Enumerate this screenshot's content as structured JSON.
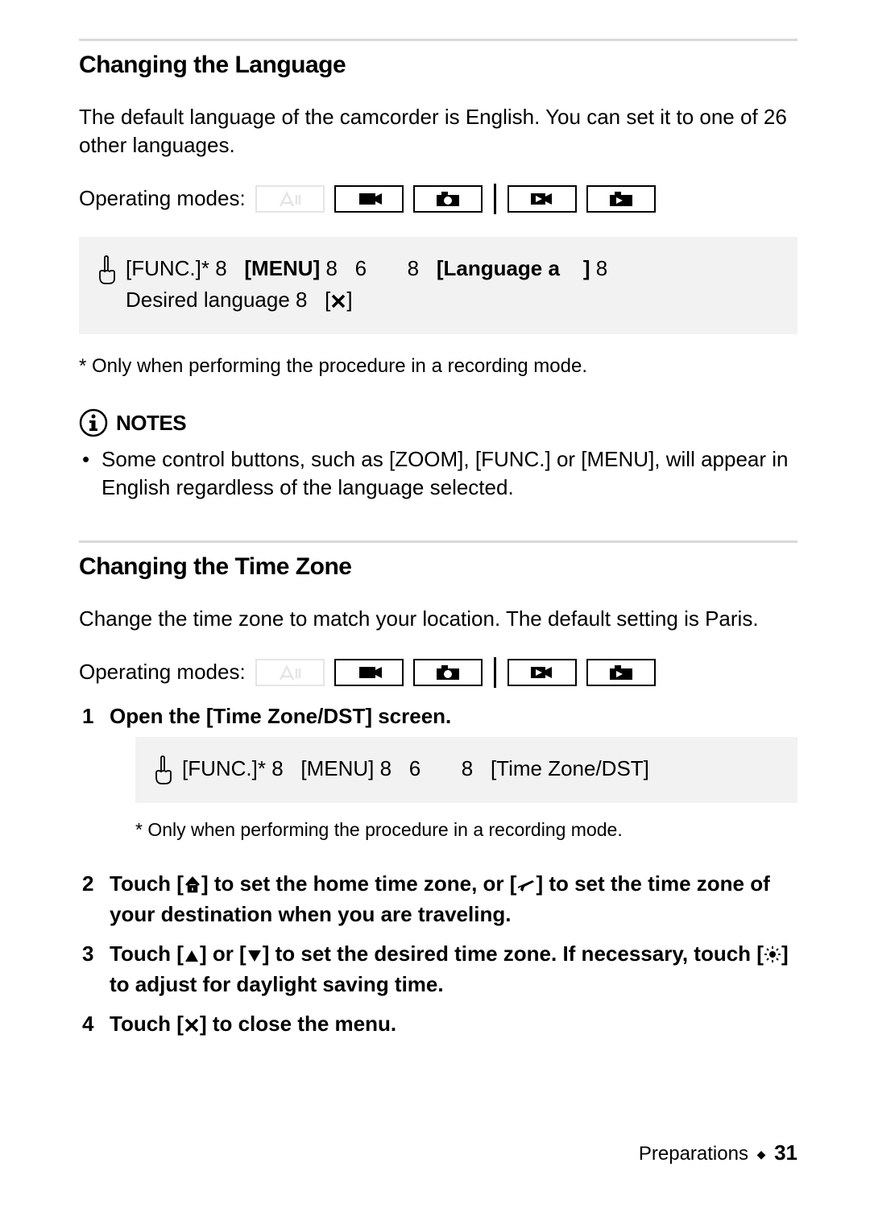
{
  "section1": {
    "heading": "Changing the Language",
    "intro": "The default language of the camcorder is English. You can set it to one of 26 other languages.",
    "modes_label": "Operating modes:",
    "touch_line1_func": "[FUNC.]*",
    "touch_line1_menu": "[MENU]",
    "touch_line1_lang": "[Language a",
    "touch_line1_close": "]",
    "touch_line2_pre": "Desired language",
    "footnote": "*  Only when performing the procedure in a recording mode.",
    "notes_label": "NOTES",
    "notes_bullet": "Some control buttons, such as [ZOOM], [FUNC.] or [MENU], will appear in English regardless of the language selected."
  },
  "section2": {
    "heading": "Changing the Time Zone",
    "intro": "Change the time zone to match your location. The default setting is Paris.",
    "modes_label": "Operating modes:",
    "step1": "Open the [Time Zone/DST] screen.",
    "touch_func": "[FUNC.]*",
    "touch_menu": "[MENU]",
    "touch_tz": "[Time Zone/DST]",
    "footnote": "*  Only when performing the procedure in a recording mode.",
    "step2a": "Touch [",
    "step2b": "] to set the home time zone, or [",
    "step2c": "] to set the time zone of your destination when you are traveling.",
    "step3a": "Touch [",
    "step3b": "] or [",
    "step3c": "] to set the desired time zone. If necessary, touch [",
    "step3d": "] to adjust for daylight saving time.",
    "step4a": "Touch [",
    "step4b": "] to close the menu."
  },
  "footer": {
    "section": "Preparations",
    "page": "31"
  },
  "sep": "8",
  "six": "6"
}
